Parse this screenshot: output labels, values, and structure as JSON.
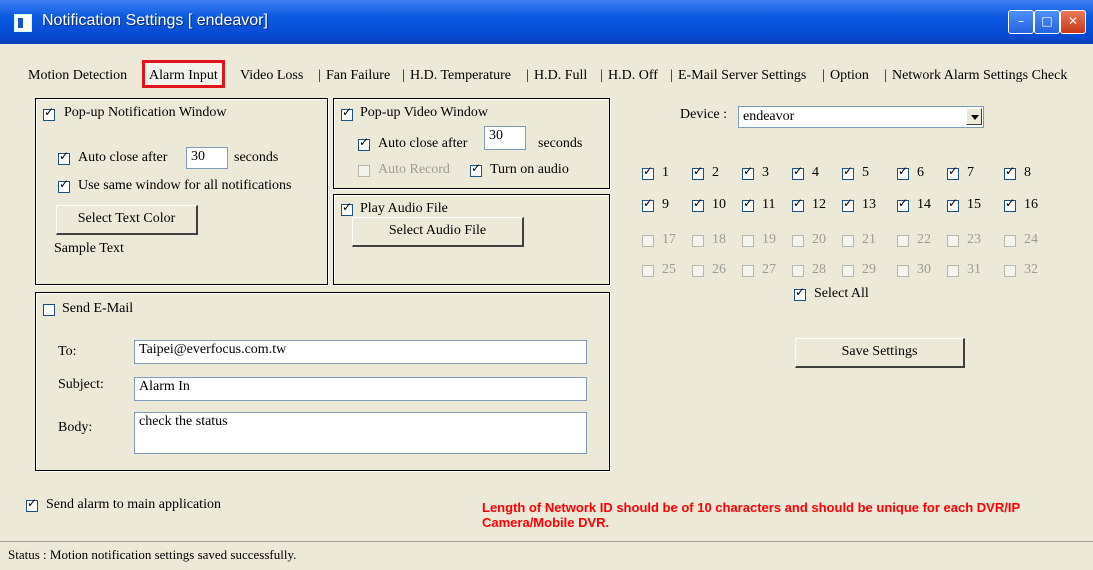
{
  "window": {
    "title": "Notification Settings  [ endeavor]"
  },
  "tabs": [
    "Motion Detection",
    "Alarm Input",
    "Video Loss",
    "Fan Failure",
    "H.D. Temperature",
    "H.D. Full",
    "H.D. Off",
    "E-Mail Server Settings",
    "Option",
    "Network Alarm Settings Check"
  ],
  "active_tab": "Alarm Input",
  "popup_notification": {
    "label": "Pop-up Notification Window",
    "checked": true,
    "auto_close_label": "Auto close after",
    "auto_close_checked": true,
    "auto_close_value": "30",
    "seconds_label": "seconds",
    "same_window_label": "Use same window for all notifications",
    "same_window_checked": true,
    "select_color_button": "Select Text Color",
    "sample_text": "Sample Text"
  },
  "popup_video": {
    "label": "Pop-up Video Window",
    "checked": true,
    "auto_close_label": "Auto close after",
    "auto_close_checked": true,
    "auto_close_value": "30",
    "seconds_label": "seconds",
    "auto_record_label": "Auto Record",
    "auto_record_checked": false,
    "turn_on_audio_label": "Turn on audio",
    "turn_on_audio_checked": true
  },
  "audio": {
    "label": "Play Audio File",
    "checked": true,
    "select_button": "Select Audio File"
  },
  "email": {
    "label": "Send E-Mail",
    "checked": false,
    "to_label": "To:",
    "to_value": "Taipei@everfocus.com.tw",
    "subject_label": "Subject:",
    "subject_value": "Alarm In",
    "body_label": "Body:",
    "body_value": "check the status"
  },
  "device": {
    "label": "Device :",
    "selected": "endeavor",
    "channels": [
      {
        "n": "1",
        "on": true,
        "enabled": true
      },
      {
        "n": "2",
        "on": true,
        "enabled": true
      },
      {
        "n": "3",
        "on": true,
        "enabled": true
      },
      {
        "n": "4",
        "on": true,
        "enabled": true
      },
      {
        "n": "5",
        "on": true,
        "enabled": true
      },
      {
        "n": "6",
        "on": true,
        "enabled": true
      },
      {
        "n": "7",
        "on": true,
        "enabled": true
      },
      {
        "n": "8",
        "on": true,
        "enabled": true
      },
      {
        "n": "9",
        "on": true,
        "enabled": true
      },
      {
        "n": "10",
        "on": true,
        "enabled": true
      },
      {
        "n": "11",
        "on": true,
        "enabled": true
      },
      {
        "n": "12",
        "on": true,
        "enabled": true
      },
      {
        "n": "13",
        "on": true,
        "enabled": true
      },
      {
        "n": "14",
        "on": true,
        "enabled": true
      },
      {
        "n": "15",
        "on": true,
        "enabled": true
      },
      {
        "n": "16",
        "on": true,
        "enabled": true
      },
      {
        "n": "17",
        "on": false,
        "enabled": false
      },
      {
        "n": "18",
        "on": false,
        "enabled": false
      },
      {
        "n": "19",
        "on": false,
        "enabled": false
      },
      {
        "n": "20",
        "on": false,
        "enabled": false
      },
      {
        "n": "21",
        "on": false,
        "enabled": false
      },
      {
        "n": "22",
        "on": false,
        "enabled": false
      },
      {
        "n": "23",
        "on": false,
        "enabled": false
      },
      {
        "n": "24",
        "on": false,
        "enabled": false
      },
      {
        "n": "25",
        "on": false,
        "enabled": false
      },
      {
        "n": "26",
        "on": false,
        "enabled": false
      },
      {
        "n": "27",
        "on": false,
        "enabled": false
      },
      {
        "n": "28",
        "on": false,
        "enabled": false
      },
      {
        "n": "29",
        "on": false,
        "enabled": false
      },
      {
        "n": "30",
        "on": false,
        "enabled": false
      },
      {
        "n": "31",
        "on": false,
        "enabled": false
      },
      {
        "n": "32",
        "on": false,
        "enabled": false
      }
    ],
    "select_all_label": "Select All",
    "select_all_checked": true,
    "save_button": "Save Settings"
  },
  "send_alarm": {
    "label": "Send alarm to main application",
    "checked": true
  },
  "notice": "Length of Network ID should be of 10 characters and should be unique for each DVR/IP Camera/Mobile DVR.",
  "status": "Status : Motion notification settings saved successfully."
}
